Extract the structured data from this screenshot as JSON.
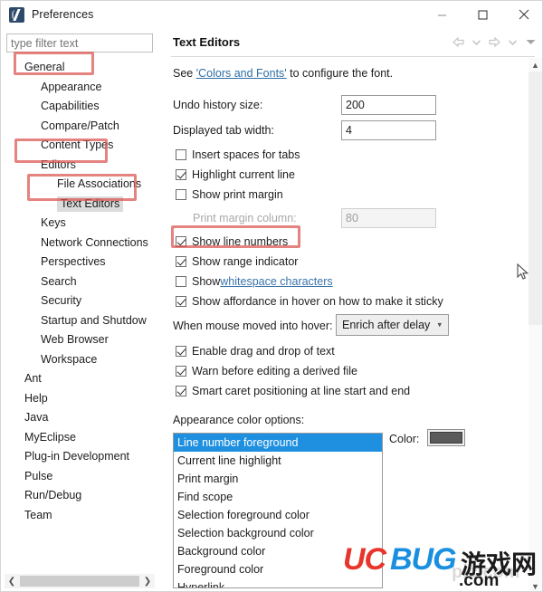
{
  "window": {
    "title": "Preferences",
    "icon": "eclipse-app-icon",
    "controls": {
      "minimize": "minimize-icon",
      "maximize": "maximize-icon",
      "close": "close-icon"
    }
  },
  "sidebar": {
    "filter": {
      "placeholder": "type filter text",
      "value": ""
    },
    "items": [
      {
        "label": "General",
        "level": 0,
        "selected": false
      },
      {
        "label": "Appearance",
        "level": 1,
        "selected": false
      },
      {
        "label": "Capabilities",
        "level": 1,
        "selected": false
      },
      {
        "label": "Compare/Patch",
        "level": 1,
        "selected": false
      },
      {
        "label": "Content Types",
        "level": 1,
        "selected": false
      },
      {
        "label": "Editors",
        "level": 1,
        "selected": false
      },
      {
        "label": "File Associations",
        "level": 2,
        "selected": false
      },
      {
        "label": "Text Editors",
        "level": 2,
        "selected": true
      },
      {
        "label": "Keys",
        "level": 1,
        "selected": false
      },
      {
        "label": "Network Connections",
        "level": 1,
        "selected": false
      },
      {
        "label": "Perspectives",
        "level": 1,
        "selected": false
      },
      {
        "label": "Search",
        "level": 1,
        "selected": false
      },
      {
        "label": "Security",
        "level": 1,
        "selected": false
      },
      {
        "label": "Startup and Shutdow",
        "level": 1,
        "selected": false
      },
      {
        "label": "Web Browser",
        "level": 1,
        "selected": false
      },
      {
        "label": "Workspace",
        "level": 1,
        "selected": false
      },
      {
        "label": "Ant",
        "level": 0,
        "selected": false
      },
      {
        "label": "Help",
        "level": 0,
        "selected": false
      },
      {
        "label": "Java",
        "level": 0,
        "selected": false
      },
      {
        "label": "MyEclipse",
        "level": 0,
        "selected": false
      },
      {
        "label": "Plug-in Development",
        "level": 0,
        "selected": false
      },
      {
        "label": "Pulse",
        "level": 0,
        "selected": false
      },
      {
        "label": "Run/Debug",
        "level": 0,
        "selected": false
      },
      {
        "label": "Team",
        "level": 0,
        "selected": false
      }
    ],
    "hscroll": {
      "left_arrow": "chevron-left-icon",
      "right_arrow": "chevron-right-icon"
    }
  },
  "page": {
    "title": "Text Editors",
    "toolbar": [
      {
        "name": "back-arrow-icon"
      },
      {
        "name": "back-dropdown-icon"
      },
      {
        "name": "forward-arrow-icon"
      },
      {
        "name": "forward-dropdown-icon"
      },
      {
        "name": "menu-dropdown-icon"
      }
    ],
    "font_note": {
      "prefix": "See ",
      "link": "'Colors and Fonts'",
      "suffix": " to configure the font."
    },
    "fields": [
      {
        "label": "Undo history size:",
        "value": "200",
        "disabled": false
      },
      {
        "label": "Displayed tab width:",
        "value": "4",
        "disabled": false
      }
    ],
    "checkboxes": [
      {
        "label": "Insert spaces for tabs",
        "checked": false,
        "dim": false
      },
      {
        "label": "Highlight current line",
        "checked": true,
        "dim": false
      },
      {
        "label": "Show print margin",
        "checked": false,
        "dim": false
      }
    ],
    "print_margin": {
      "label": "Print margin column:",
      "value": "80",
      "disabled": true
    },
    "checkboxes2": [
      {
        "label": "Show line numbers",
        "checked": true,
        "dim": false
      },
      {
        "label": "Show range indicator",
        "checked": true,
        "dim": false
      }
    ],
    "whitespace_row": {
      "prefix": "Show ",
      "link": "whitespace characters",
      "checked": false
    },
    "affordance_row": {
      "label": "Show affordance in hover on how to make it sticky",
      "checked": true
    },
    "hover": {
      "label": "When mouse moved into hover:",
      "selected": "Enrich after delay",
      "caret": "chevron-down-icon"
    },
    "checkboxes3": [
      {
        "label": "Enable drag and drop of text",
        "checked": true
      },
      {
        "label": "Warn before editing a derived file",
        "checked": true
      },
      {
        "label": "Smart caret positioning at line start and end",
        "checked": true
      }
    ],
    "appearance": {
      "label": "Appearance color options:",
      "options": [
        "Line number foreground",
        "Current line highlight",
        "Print margin",
        "Find scope",
        "Selection foreground color",
        "Selection background color",
        "Background color",
        "Foreground color",
        "Hyperlink"
      ],
      "selected_index": 0,
      "color_label": "Color:",
      "color_value": "#5a5a5a"
    },
    "scrollbar": {
      "up": "chevron-up-icon",
      "down": "chevron-down-icon"
    }
  },
  "annotations": {
    "highlight_color": "#d9534f",
    "boxes": [
      {
        "name": "highlight-general"
      },
      {
        "name": "highlight-editors"
      },
      {
        "name": "highlight-text-editors"
      },
      {
        "name": "highlight-show-line-numbers"
      }
    ]
  },
  "watermark": {
    "uc": "UC",
    "bug": "BUG",
    "cn": "游戏网",
    "com": ".com",
    "ghost": "pic.com"
  }
}
